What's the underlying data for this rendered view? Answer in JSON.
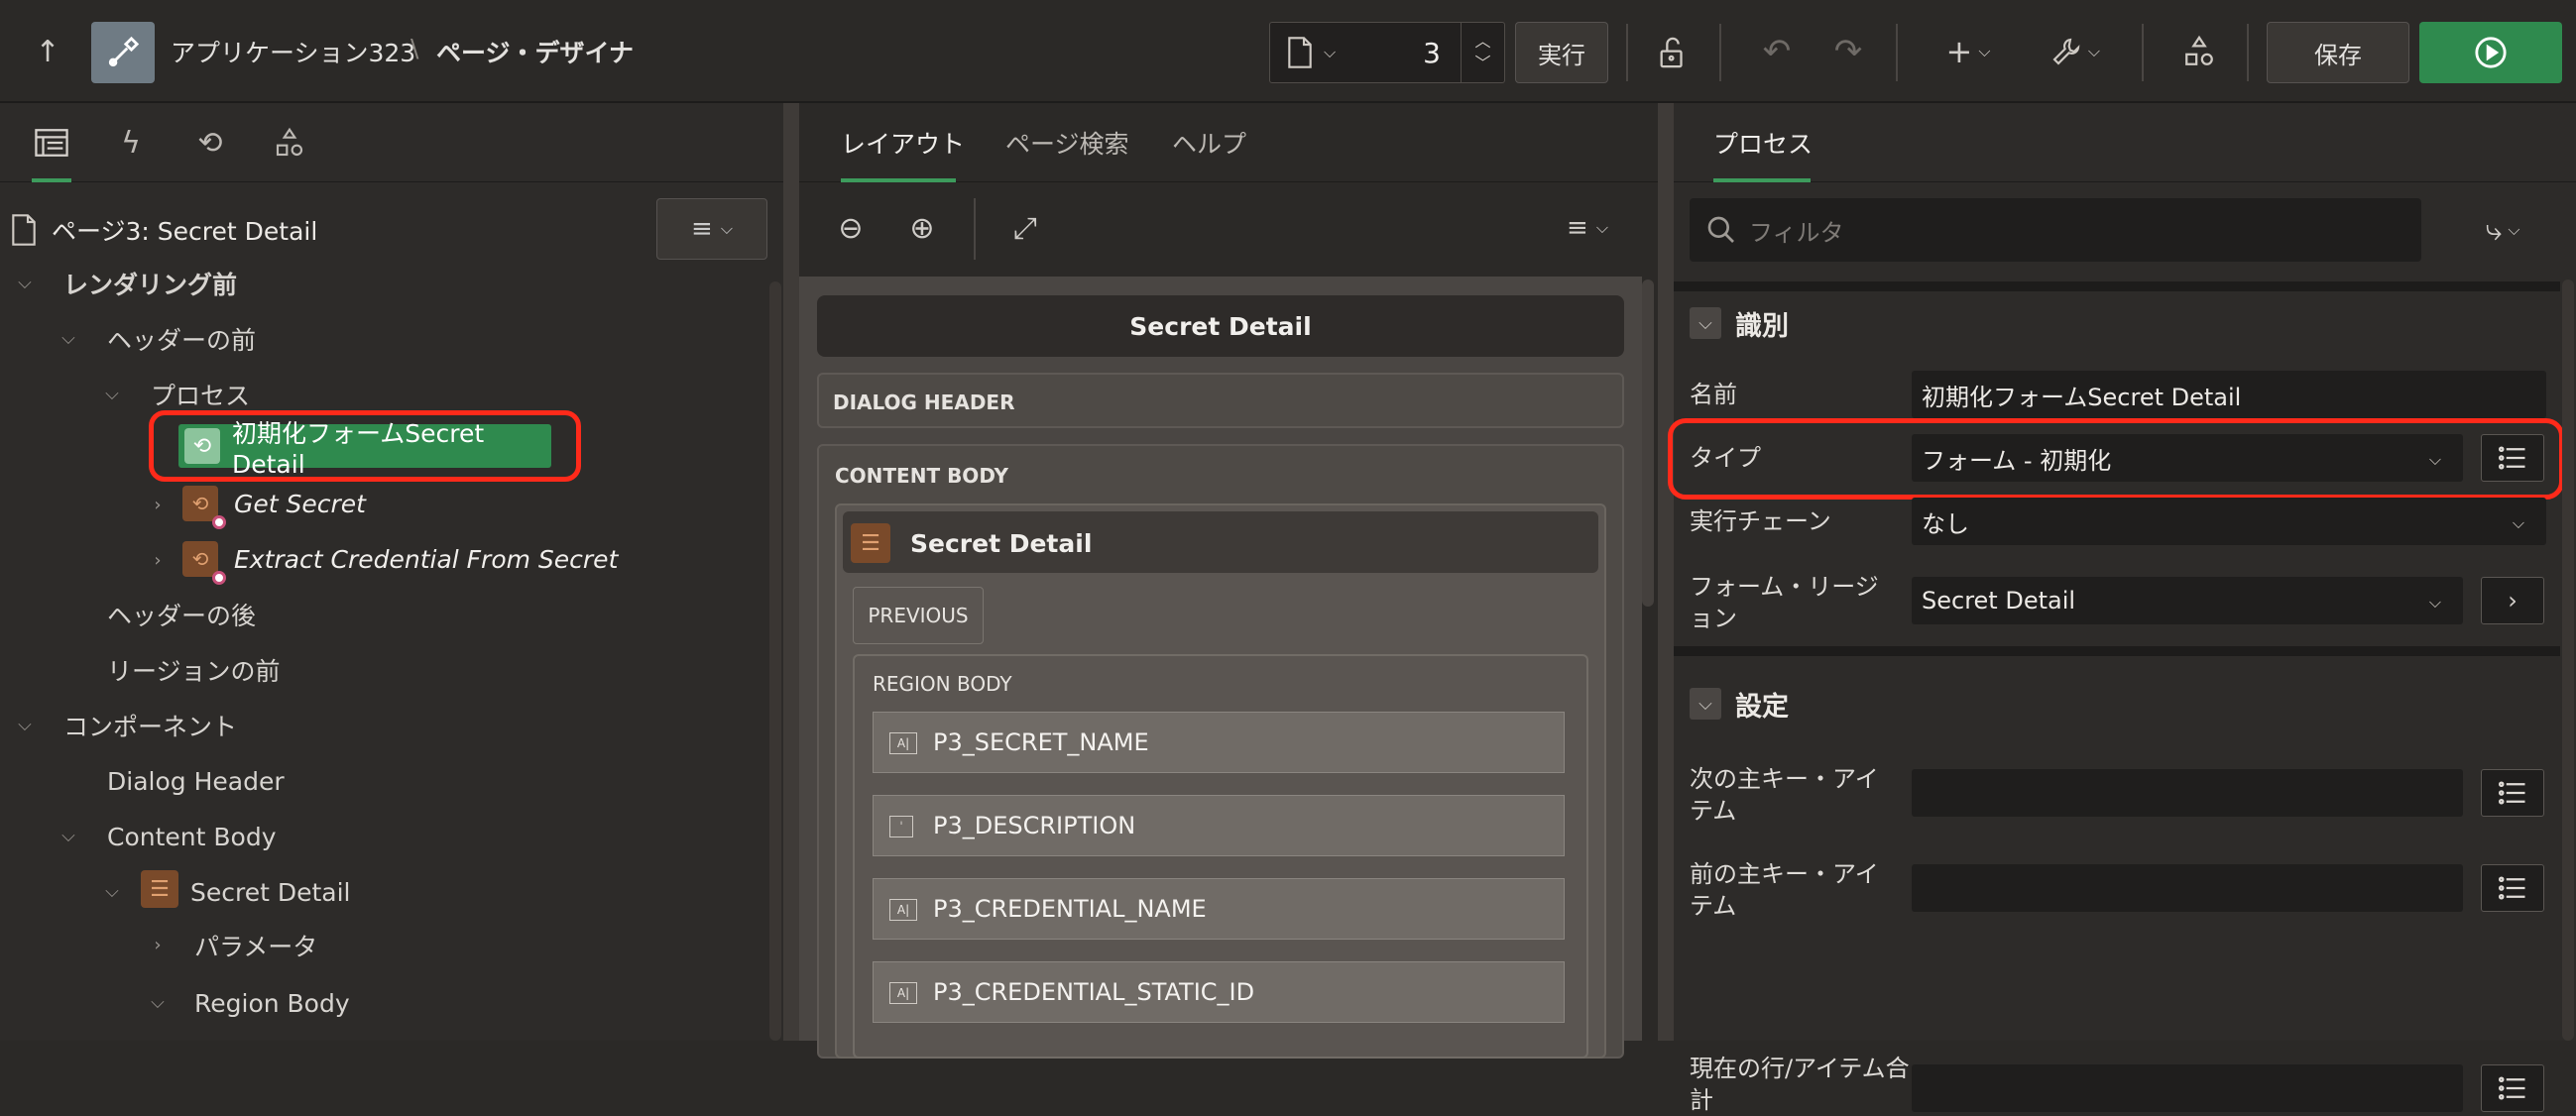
{
  "app": {
    "breadcrumb_app": "アプリケーション323",
    "breadcrumb_sep": "\\",
    "breadcrumb_page": "ページ・デザイナ"
  },
  "toolbar": {
    "page_number": "3",
    "run_label": "実行",
    "save_label": "保存"
  },
  "left": {
    "page_title": "ページ3: Secret Detail",
    "tree": [
      {
        "label": "レンダリング前",
        "level": 0,
        "bold": true
      },
      {
        "label": "ヘッダーの前",
        "level": 1
      },
      {
        "label": "プロセス",
        "level": 2
      },
      {
        "label": "初期化フォームSecret Detail",
        "level": 3,
        "selected": true
      },
      {
        "label": "Get Secret",
        "level": 3,
        "italic": true
      },
      {
        "label": "Extract Credential From Secret",
        "level": 3,
        "italic": true
      },
      {
        "label": "ヘッダーの後",
        "level": 1
      },
      {
        "label": "リージョンの前",
        "level": 1
      },
      {
        "label": "コンポーネント",
        "level": 0
      },
      {
        "label": "Dialog Header",
        "level": 1
      },
      {
        "label": "Content Body",
        "level": 1
      },
      {
        "label": "Secret Detail",
        "level": 2
      },
      {
        "label": "パラメータ",
        "level": 3
      },
      {
        "label": "Region Body",
        "level": 3
      }
    ]
  },
  "mid": {
    "tabs": [
      "レイアウト",
      "ページ検索",
      "ヘルプ"
    ],
    "page_header": "Secret Detail",
    "dialog_header": "DIALOG HEADER",
    "content_body": "CONTENT BODY",
    "region_title": "Secret Detail",
    "previous": "PREVIOUS",
    "region_body": "REGION BODY",
    "items": [
      "P3_SECRET_NAME",
      "P3_DESCRIPTION",
      "P3_CREDENTIAL_NAME",
      "P3_CREDENTIAL_STATIC_ID"
    ]
  },
  "right": {
    "tab": "プロセス",
    "filter_placeholder": "フィルタ",
    "section1": "識別",
    "name_label": "名前",
    "name_value": "初期化フォームSecret Detail",
    "type_label": "タイプ",
    "type_value": "フォーム - 初期化",
    "chain_label": "実行チェーン",
    "chain_value": "なし",
    "region_label": "フォーム・リージョン",
    "region_value": "Secret Detail",
    "section2": "設定",
    "next_label": "次の主キー・アイテム",
    "prev_label": "前の主キー・アイテム",
    "cur_label": "現在の行/アイテム合計"
  },
  "colors": {
    "accent_green": "#2f8a4e",
    "highlight_red": "#ff2a1a"
  }
}
